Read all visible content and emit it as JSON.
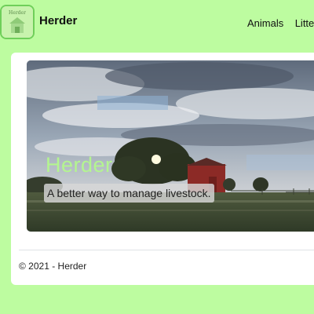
{
  "navbar": {
    "brand": "Herder",
    "logo_text": "Herder",
    "links": [
      "Animals",
      "Litters"
    ]
  },
  "hero": {
    "title": "Herder",
    "tagline": "A better way to manage livestock."
  },
  "footer": {
    "text": "© 2021 - Herder"
  },
  "colors": {
    "page_background": "#bdfca0",
    "hero_title": "#b4f590",
    "logo_border": "#6fcf5a"
  }
}
